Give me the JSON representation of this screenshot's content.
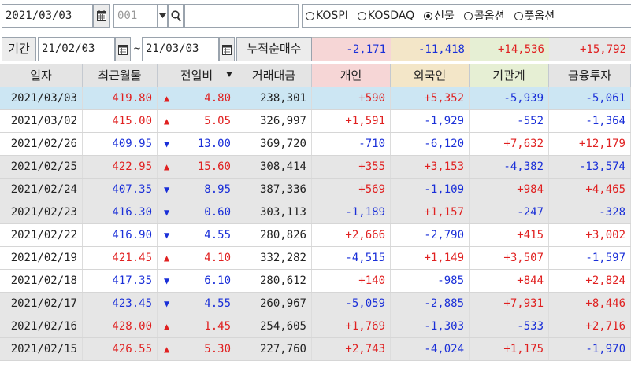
{
  "toolbar": {
    "date": "2021/03/03",
    "code": "001",
    "search_text": "",
    "radios": [
      {
        "label": "KOSPI",
        "selected": false
      },
      {
        "label": "KOSDAQ",
        "selected": false
      },
      {
        "label": "선물",
        "selected": true
      },
      {
        "label": "콜옵션",
        "selected": false
      },
      {
        "label": "풋옵션",
        "selected": false
      }
    ]
  },
  "period": {
    "label": "기간",
    "start": "21/02/03",
    "sep": "~",
    "end": "21/03/03",
    "cum_label": "누적순매수",
    "cum_values": [
      {
        "value": "-2,171",
        "color": "blue",
        "bg": "#f6d6d6"
      },
      {
        "value": "-11,418",
        "color": "blue",
        "bg": "#f3e6c8"
      },
      {
        "value": "+14,536",
        "color": "red",
        "bg": "#e6efd4"
      },
      {
        "value": "+15,792",
        "color": "red",
        "bg": "#e8e8e8"
      }
    ]
  },
  "columns": [
    {
      "label": "일자",
      "bg": "#e4e4e4"
    },
    {
      "label": "최근월물",
      "bg": "#e4e4e4"
    },
    {
      "label": "전일비",
      "bg": "#e4e4e4"
    },
    {
      "label": "거래대금",
      "bg": "#e4e4e4"
    },
    {
      "label": "개인",
      "bg": "#f6d6d6"
    },
    {
      "label": "외국인",
      "bg": "#f3e6c8"
    },
    {
      "label": "기관계",
      "bg": "#e6efd4"
    },
    {
      "label": "금융투자",
      "bg": "#e4e4e4"
    }
  ],
  "rows": [
    {
      "date": "2021/03/03",
      "price": "419.80",
      "dir": "up",
      "change": "4.80",
      "amount": "238,301",
      "indiv": "+590",
      "foreign": "+5,352",
      "inst": "-5,939",
      "fin": "-5,061"
    },
    {
      "date": "2021/03/02",
      "price": "415.00",
      "dir": "up",
      "change": "5.05",
      "amount": "326,997",
      "indiv": "+1,591",
      "foreign": "-1,929",
      "inst": "-552",
      "fin": "-1,364"
    },
    {
      "date": "2021/02/26",
      "price": "409.95",
      "dir": "down",
      "change": "13.00",
      "amount": "369,720",
      "indiv": "-710",
      "foreign": "-6,120",
      "inst": "+7,632",
      "fin": "+12,179"
    },
    {
      "date": "2021/02/25",
      "price": "422.95",
      "dir": "up",
      "change": "15.60",
      "amount": "308,414",
      "indiv": "+355",
      "foreign": "+3,153",
      "inst": "-4,382",
      "fin": "-13,574"
    },
    {
      "date": "2021/02/24",
      "price": "407.35",
      "dir": "down",
      "change": "8.95",
      "amount": "387,336",
      "indiv": "+569",
      "foreign": "-1,109",
      "inst": "+984",
      "fin": "+4,465"
    },
    {
      "date": "2021/02/23",
      "price": "416.30",
      "dir": "down",
      "change": "0.60",
      "amount": "303,113",
      "indiv": "-1,189",
      "foreign": "+1,157",
      "inst": "-247",
      "fin": "-328"
    },
    {
      "date": "2021/02/22",
      "price": "416.90",
      "dir": "down",
      "change": "4.55",
      "amount": "280,826",
      "indiv": "+2,666",
      "foreign": "-2,790",
      "inst": "+415",
      "fin": "+3,002"
    },
    {
      "date": "2021/02/19",
      "price": "421.45",
      "dir": "up",
      "change": "4.10",
      "amount": "332,282",
      "indiv": "-4,515",
      "foreign": "+1,149",
      "inst": "+3,507",
      "fin": "-1,597"
    },
    {
      "date": "2021/02/18",
      "price": "417.35",
      "dir": "down",
      "change": "6.10",
      "amount": "280,612",
      "indiv": "+140",
      "foreign": "-985",
      "inst": "+844",
      "fin": "+2,824"
    },
    {
      "date": "2021/02/17",
      "price": "423.45",
      "dir": "down",
      "change": "4.55",
      "amount": "260,967",
      "indiv": "-5,059",
      "foreign": "-2,885",
      "inst": "+7,931",
      "fin": "+8,446"
    },
    {
      "date": "2021/02/16",
      "price": "428.00",
      "dir": "up",
      "change": "1.45",
      "amount": "254,605",
      "indiv": "+1,769",
      "foreign": "-1,303",
      "inst": "-533",
      "fin": "+2,716"
    },
    {
      "date": "2021/02/15",
      "price": "426.55",
      "dir": "up",
      "change": "5.30",
      "amount": "227,760",
      "indiv": "+2,743",
      "foreign": "-4,024",
      "inst": "+1,175",
      "fin": "-1,970"
    }
  ],
  "style": {
    "selected_row_bg": "#cce6f3",
    "row_bg_a": "#ffffff",
    "row_bg_b": "#e6e6e6",
    "up_color": "#e02020",
    "down_color": "#1a2fd8"
  },
  "icons": {
    "calendar": "calendar-icon",
    "dropdown": "chevron-down-icon",
    "search": "search-icon",
    "sort": "sort-down-icon"
  }
}
